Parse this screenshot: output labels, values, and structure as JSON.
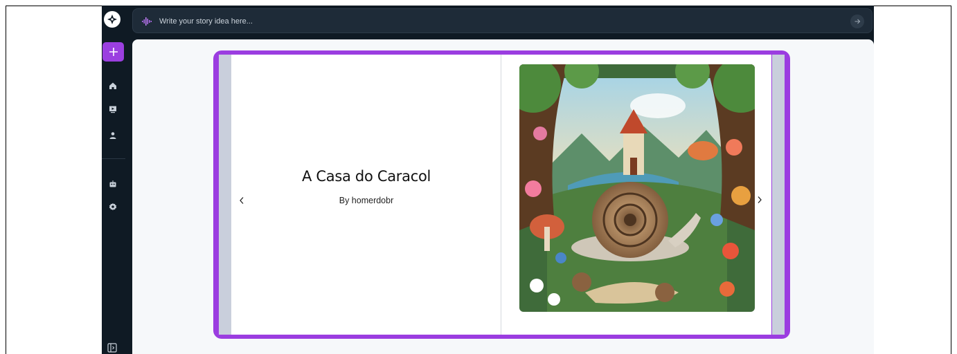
{
  "app": {
    "search": {
      "placeholder": "Write your story idea here...",
      "value": ""
    },
    "sidebar": {
      "items": [
        {
          "name": "new",
          "icon": "plus-icon"
        },
        {
          "name": "home",
          "icon": "home-icon"
        },
        {
          "name": "slideshow",
          "icon": "presentation-icon"
        },
        {
          "name": "profile",
          "icon": "user-icon"
        },
        {
          "name": "bot",
          "icon": "robot-icon"
        },
        {
          "name": "settings",
          "icon": "gear-icon"
        },
        {
          "name": "panel",
          "icon": "panel-toggle-icon"
        }
      ]
    }
  },
  "book": {
    "title": "A Casa do Caracol",
    "author": "By homerdobr"
  },
  "colors": {
    "accent": "#9b3de0",
    "sidebar_bg": "#0f1a24",
    "content_bg": "#f6f8fa",
    "page_edge": "#c9cfdc"
  }
}
